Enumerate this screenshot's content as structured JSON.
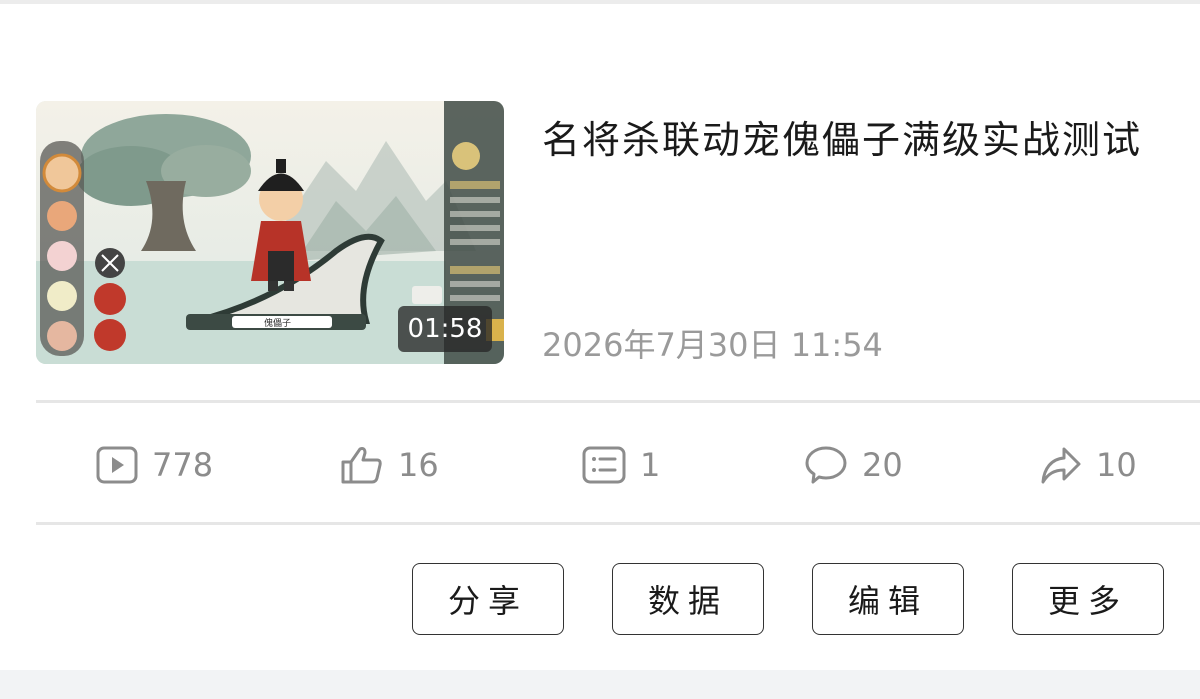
{
  "video": {
    "title": "名将杀联动宠傀儡子满级实战测试",
    "duration": "01:58",
    "published": "2026年7月30日 11:54",
    "thumbnail_caption": "傀儡子"
  },
  "stats": {
    "views": "778",
    "likes": "16",
    "danmaku": "1",
    "comments": "20",
    "shares": "10"
  },
  "icons": {
    "views": "play-icon",
    "likes": "thumbs-up-icon",
    "danmaku": "list-icon",
    "comments": "comment-icon",
    "shares": "share-icon"
  },
  "actions": {
    "share": "分享",
    "data": "数据",
    "edit": "编辑",
    "more": "更多"
  }
}
